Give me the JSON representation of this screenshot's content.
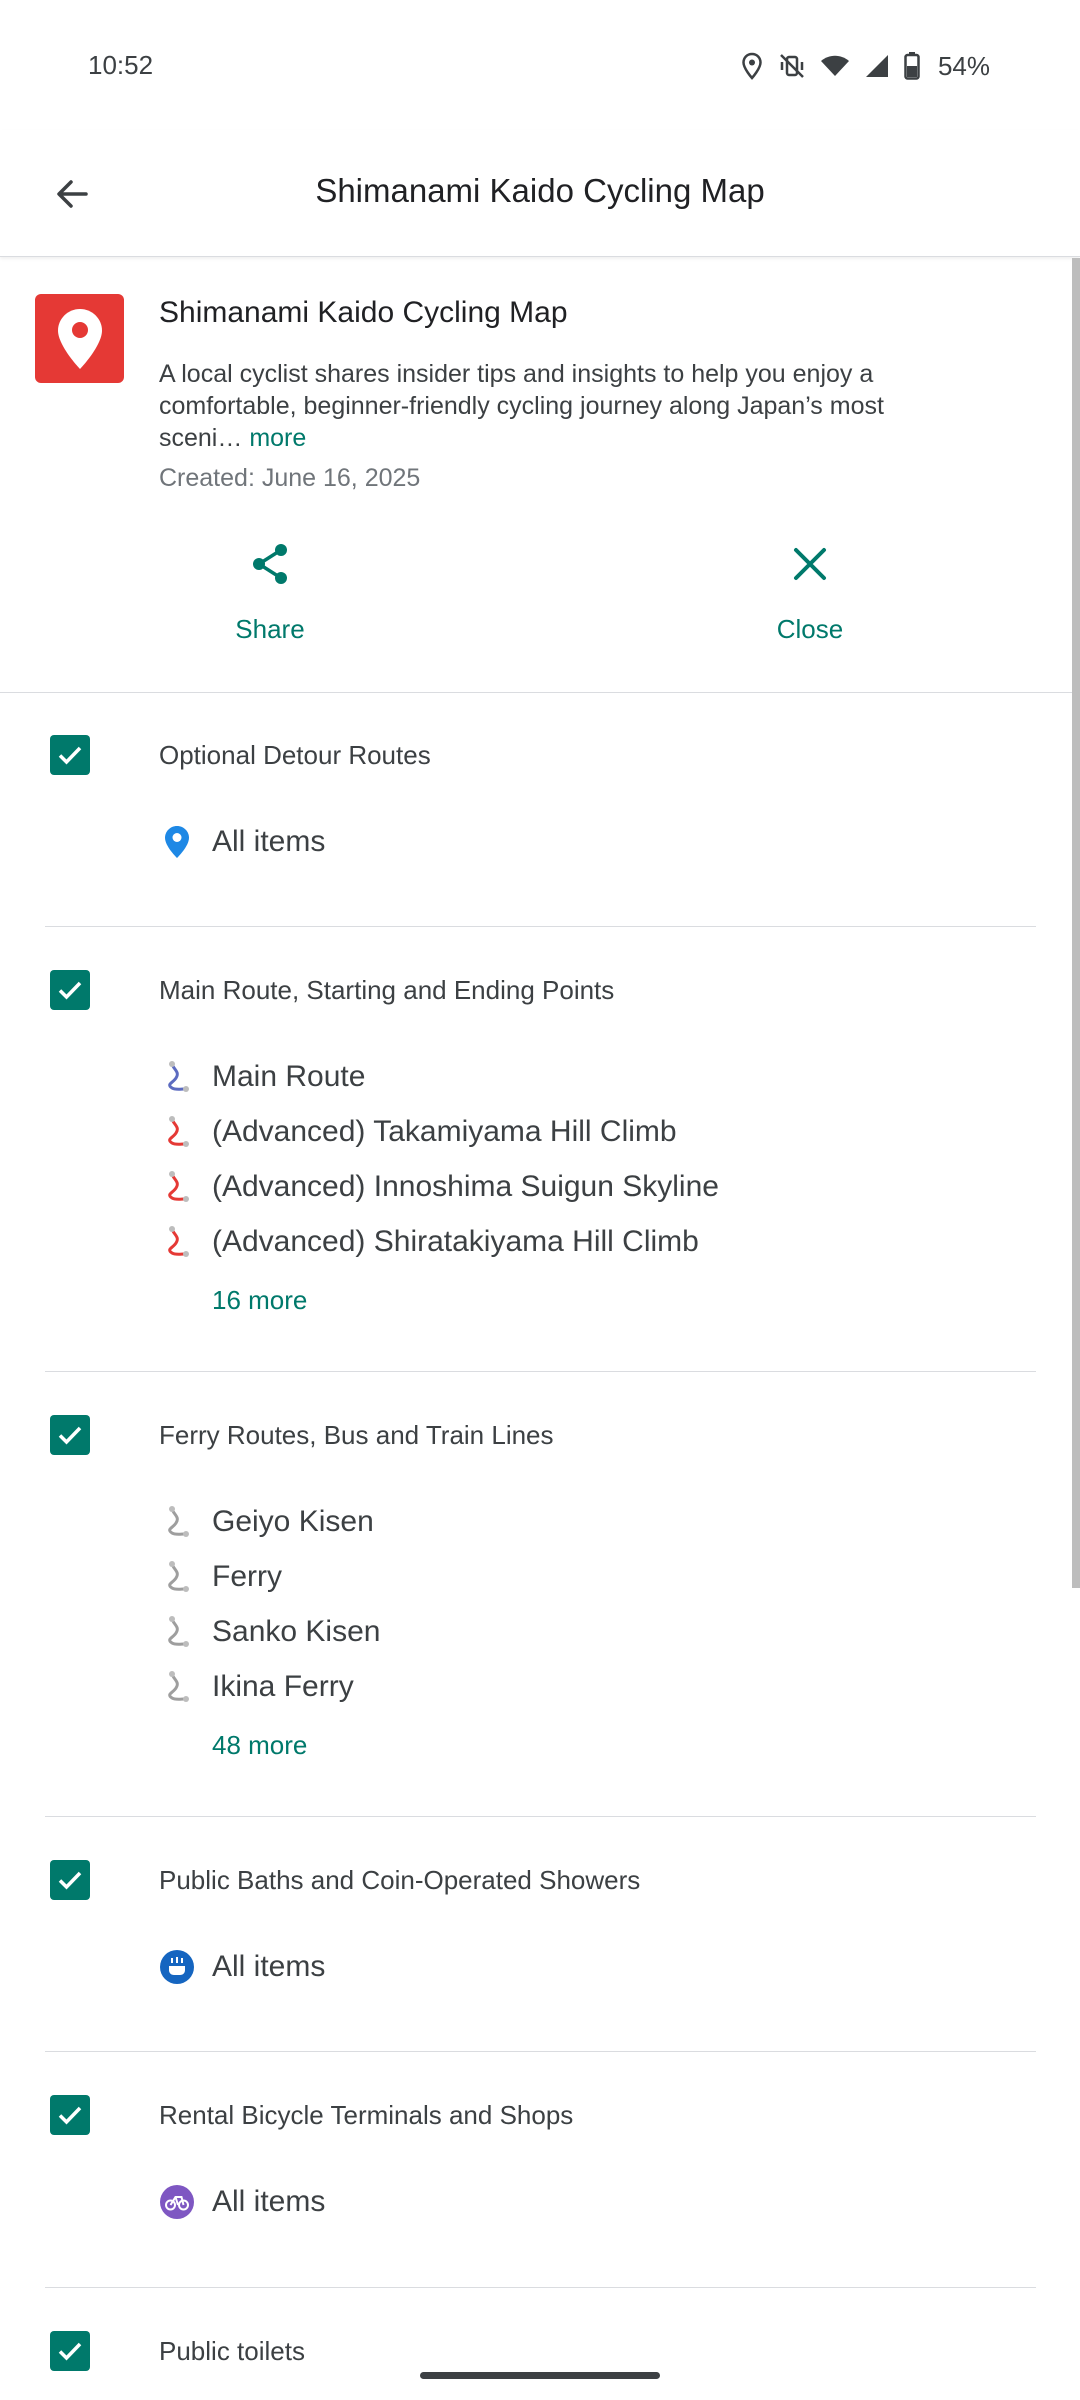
{
  "status_bar": {
    "time": "10:52",
    "battery": "54%"
  },
  "app_bar": {
    "title": "Shimanami Kaido Cycling Map"
  },
  "map": {
    "name": "Shimanami Kaido Cycling Map",
    "description": "A local cyclist shares insider tips and insights to help you enjoy a comfortable, beginner-friendly cycling journey along Japan’s most sceni…",
    "more_label": "more",
    "created": "Created: June 16, 2025",
    "brand_color": "#e53935"
  },
  "actions": {
    "share": "Share",
    "close": "Close"
  },
  "accent_color": "#00796b",
  "layers": [
    {
      "title": "Optional Detour Routes",
      "items": [
        {
          "label": "All items",
          "icon": "place-pin-icon"
        }
      ]
    },
    {
      "title": "Main Route, Starting and Ending Points",
      "items": [
        {
          "label": "Main Route",
          "icon": "route-icon-blue"
        },
        {
          "label": "(Advanced) Takamiyama Hill Climb",
          "icon": "route-icon-red"
        },
        {
          "label": "(Advanced) Innoshima Suigun Skyline",
          "icon": "route-icon-red"
        },
        {
          "label": "(Advanced) Shiratakiyama Hill Climb",
          "icon": "route-icon-red"
        }
      ],
      "more": "16 more"
    },
    {
      "title": "Ferry Routes, Bus and Train Lines",
      "items": [
        {
          "label": "Geiyo Kisen",
          "icon": "route-icon-gray"
        },
        {
          "label": "Ferry",
          "icon": "route-icon-gray"
        },
        {
          "label": "Sanko Kisen",
          "icon": "route-icon-gray"
        },
        {
          "label": "Ikina Ferry",
          "icon": "route-icon-gray"
        }
      ],
      "more": "48 more"
    },
    {
      "title": "Public Baths and Coin-Operated Showers",
      "items": [
        {
          "label": "All items",
          "icon": "bath-icon"
        }
      ]
    },
    {
      "title": "Rental Bicycle Terminals and Shops",
      "items": [
        {
          "label": "All items",
          "icon": "bicycle-icon"
        }
      ]
    },
    {
      "title": "Public toilets",
      "items": []
    }
  ]
}
